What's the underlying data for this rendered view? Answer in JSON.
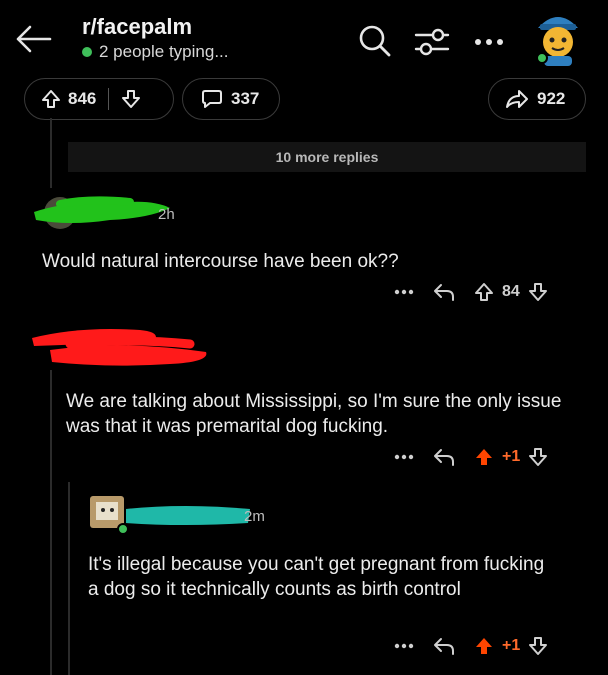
{
  "header": {
    "subreddit": "r/facepalm",
    "status": "2 people typing..."
  },
  "post_bar": {
    "upvotes": "846",
    "comments": "337",
    "shares": "922"
  },
  "more_replies": "10 more replies",
  "comments": [
    {
      "time": "2h",
      "text": "Would natural intercourse have been ok??",
      "score": "84"
    },
    {
      "text": "We are talking about Mississippi, so I'm sure the only issue was that it was premarital dog fucking.",
      "score": "+1"
    },
    {
      "time": "2m",
      "text": "It's illegal because you can't get pregnant from fucking a dog so it technically counts as birth control",
      "score": "+1"
    }
  ],
  "colors": {
    "upvote_active": "#ff4500",
    "redaction_green": "#22c21b",
    "redaction_red": "#ff1a1a",
    "redaction_teal": "#1fb8a8"
  }
}
